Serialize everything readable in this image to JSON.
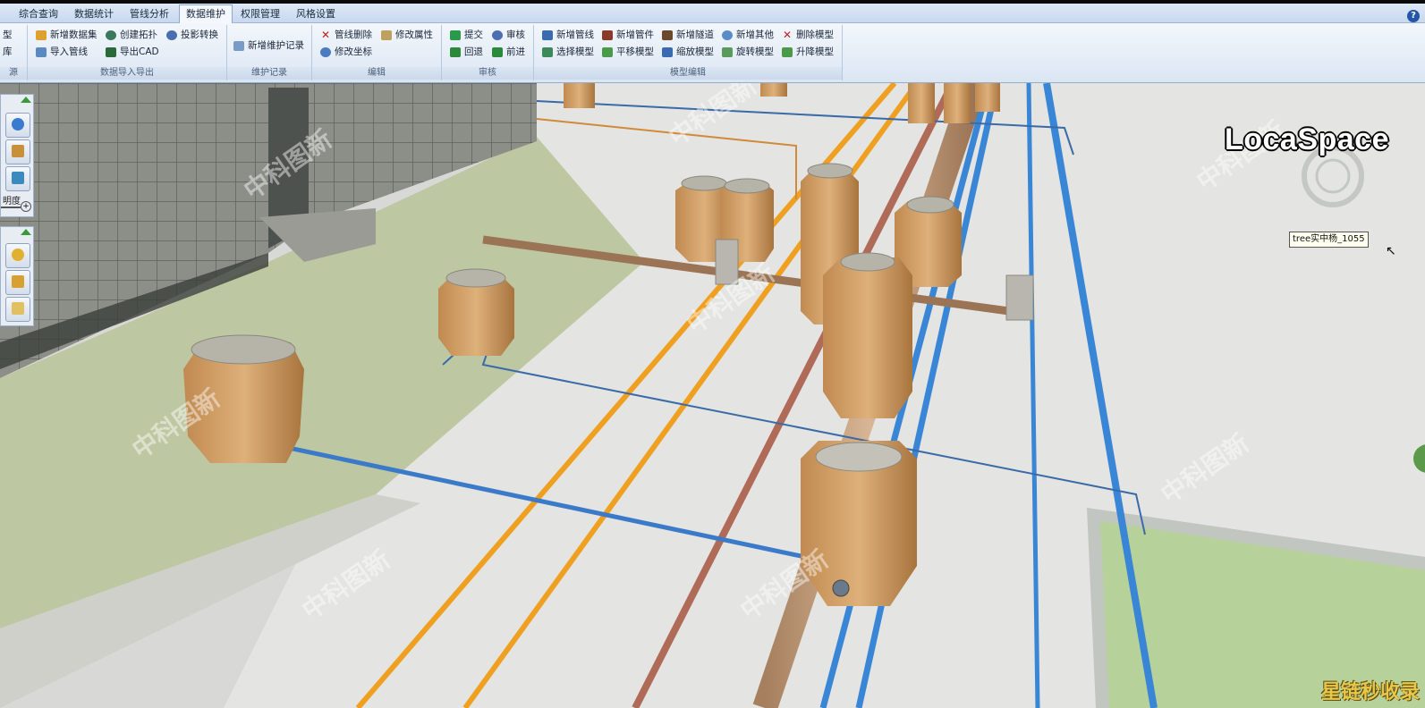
{
  "menu": {
    "tabs": [
      "综合查询",
      "数据统计",
      "管线分析",
      "数据维护",
      "权限管理",
      "风格设置"
    ],
    "active_tab": "数据维护",
    "help_label": "?"
  },
  "ribbon": {
    "partial_group": {
      "items": [
        "型",
        "库"
      ],
      "title": "源"
    },
    "import_export": {
      "title": "数据导入导出",
      "items": [
        "新增数据集",
        "创建拓扑",
        "投影转换",
        "导入管线",
        "导出CAD"
      ]
    },
    "maintain_record": {
      "title": "维护记录",
      "items": [
        "新增维护记录"
      ]
    },
    "edit": {
      "title": "编辑",
      "items": [
        "管线删除",
        "修改属性",
        "修改坐标"
      ]
    },
    "review": {
      "title": "审核",
      "items": [
        "提交",
        "审核",
        "回退",
        "前进"
      ]
    },
    "model_edit": {
      "title": "模型编辑",
      "items": [
        "新增管线",
        "新增管件",
        "新增隧道",
        "新增其他",
        "删除模型",
        "选择模型",
        "平移模型",
        "缩放模型",
        "旋转模型",
        "升降模型"
      ]
    }
  },
  "left_panel": {
    "label": "明度"
  },
  "viewport": {
    "brand": "LocaSpace",
    "tooltip": "tree实中杨_1055",
    "watermark": "中科图新",
    "corner_text": "星链秒收录"
  },
  "colors": {
    "accent": "#2456a8",
    "pipe_blue": "#3a86d6",
    "pipe_orange": "#f0a020",
    "pipe_red": "#b06050"
  }
}
